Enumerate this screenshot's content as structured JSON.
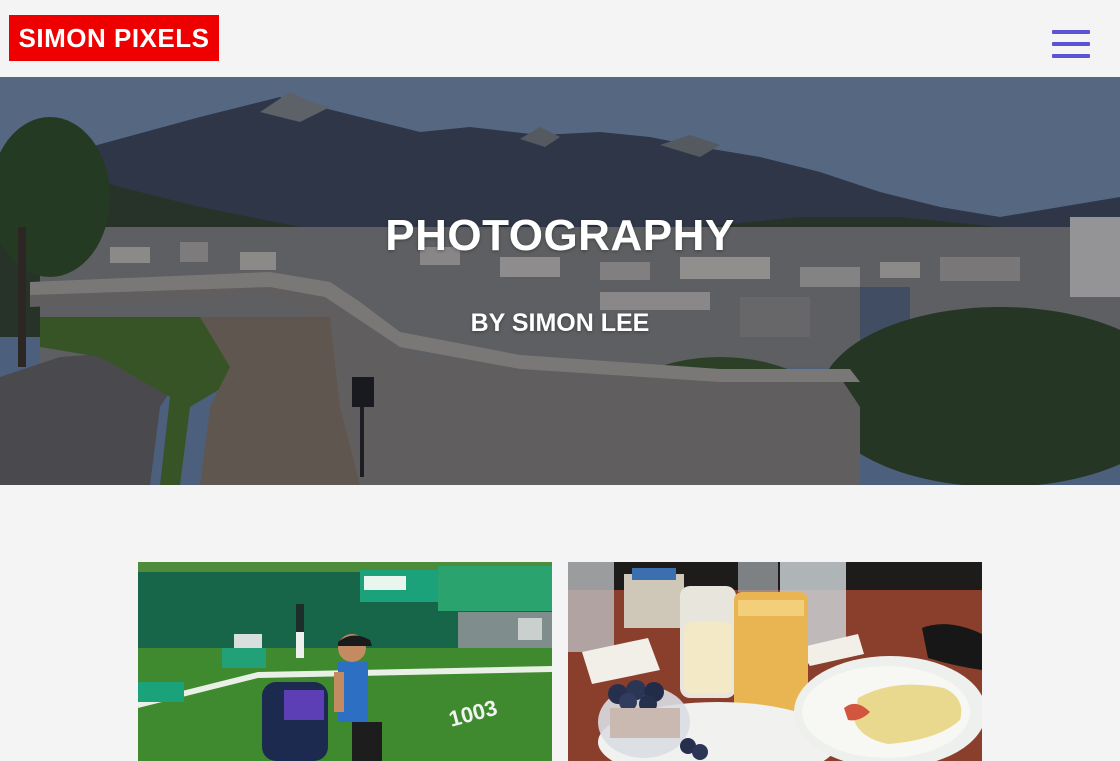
{
  "header": {
    "logo_text": "SIMON PIXELS",
    "menu_icon": "hamburger-menu-icon"
  },
  "hero": {
    "title": "PHOTOGRAPHY",
    "subtitle": "BY SIMON LEE"
  },
  "gallery": {
    "photos": [
      {
        "subject": "tennis-player-photo"
      },
      {
        "subject": "breakfast-photo"
      }
    ]
  },
  "colors": {
    "logo_background": "#ee0000",
    "menu_icon": "#5b52d6",
    "page_background": "#f4f4f4"
  }
}
